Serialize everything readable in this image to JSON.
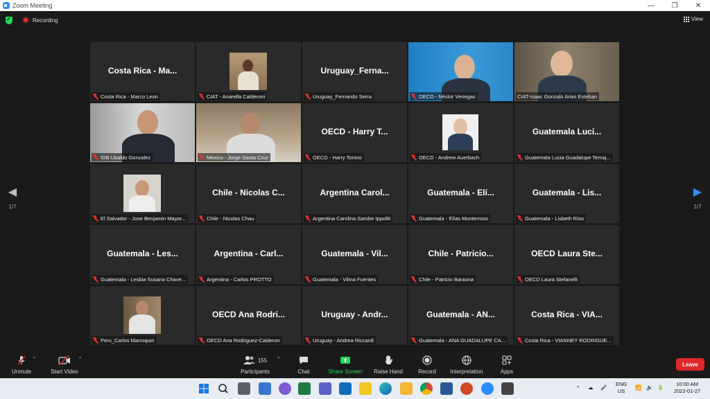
{
  "window": {
    "title": "Zoom Meeting",
    "minimize": "—",
    "maximize": "❐",
    "close": "✕"
  },
  "topbar": {
    "recording_label": "Recording",
    "view_label": "View"
  },
  "navigation": {
    "left_page": "1/7",
    "right_page": "1/7",
    "left_arrow": "◀",
    "right_arrow": "▶"
  },
  "tiles": [
    {
      "big": "Costa Rica - Ma...",
      "label": "Costa Rica - Marco Leon"
    },
    {
      "big": "",
      "label": "CIAT - Anarella Calderoni"
    },
    {
      "big": "Uruguay_Ferna...",
      "label": "Uruguay_Fernando Serra"
    },
    {
      "big": "",
      "label": "OECD - Néstor Venegas"
    },
    {
      "big": "",
      "label": "CIAT-Isaac Gonzalo Arias Esteban"
    },
    {
      "big": "",
      "label": "IDB Ubaldo Gonzalez"
    },
    {
      "big": "",
      "label": "Mexico - Jorge Santa Cruz"
    },
    {
      "big": "OECD - Harry T...",
      "label": "OECD - Harry Tonino"
    },
    {
      "big": "",
      "label": "OECD - Andrew Auerbach"
    },
    {
      "big": "Guatemala  Luci...",
      "label": "Guatemala Lucia Guadalupe Temaj..."
    },
    {
      "big": "",
      "label": "El Salvador - Jose Benjamin Mayor..."
    },
    {
      "big": "Chile - Nicolas C...",
      "label": "Chile - Nicolas Chau"
    },
    {
      "big": "Argentina Carol...",
      "label": "Argentina Carolina Sarobe Ippoliti"
    },
    {
      "big": "Guatemala - Elí...",
      "label": "Guatemala - Elías Monterroso"
    },
    {
      "big": "Guatemala - Lis...",
      "label": "Guatemala - Lisbeth Ríos"
    },
    {
      "big": "Guatemala - Les...",
      "label": "Guatemala - Lesbia Susana Chave..."
    },
    {
      "big": "Argentina - Carl...",
      "label": "Argentina - Carlos PROTTO"
    },
    {
      "big": "Guatemala - Vil...",
      "label": "Guatemala - Vilma Fuentes"
    },
    {
      "big": "Chile - Patricio...",
      "label": "Chile - Patricio Baraona"
    },
    {
      "big": "OECD Laura Ste...",
      "label": "OECD Laura Stefanelli"
    },
    {
      "big": "",
      "label": "Peru_Carlos Marroquin"
    },
    {
      "big": "OECD Ana Rodri...",
      "label": "OECD Ana Rodriguez-Calderon"
    },
    {
      "big": "Uruguay - Andr...",
      "label": "Uruguay - Andrea Riccardi"
    },
    {
      "big": "Guatemala - AN...",
      "label": "Guatemala - ANA GUADALUPE CA..."
    },
    {
      "big": "Costa Rica - VIA...",
      "label": "Costa Rica - VIANNEY RODRIGUE..."
    }
  ],
  "toolbar": {
    "unmute": "Unmute",
    "start_video": "Start Video",
    "participants": "Participants",
    "participants_count": "155",
    "chat": "Chat",
    "share_screen": "Share Screen",
    "raise_hand": "Raise Hand",
    "record": "Record",
    "interpretation": "Interpretation",
    "apps": "Apps",
    "leave": "Leave",
    "caret": "^"
  },
  "taskbar": {
    "lang_top": "ENG",
    "lang_bottom": "US",
    "time": "10:00 AM",
    "date": "2022-01-27",
    "tray_caret": "^"
  },
  "colors": {
    "accent": "#2d8cff",
    "share_green": "#23d959",
    "leave_red": "#e02828",
    "active_speaker": "#c9e45a"
  }
}
